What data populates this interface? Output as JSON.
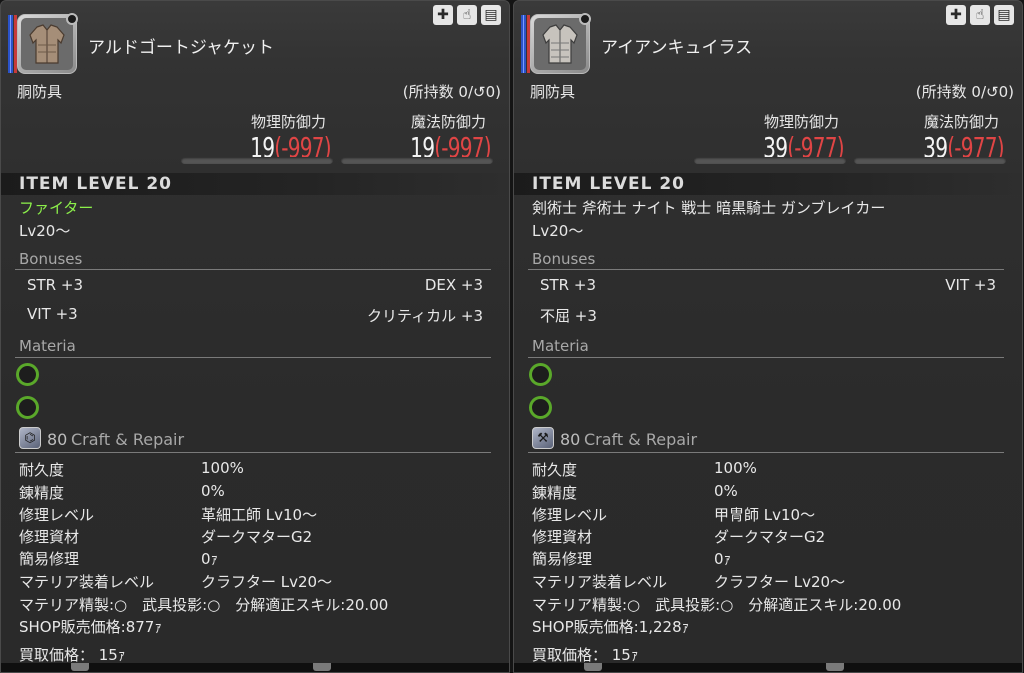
{
  "panels": [
    {
      "item_name": "アルドゴートジャケット",
      "category": "胴防具",
      "owned": "(所持数 0/",
      "owned_suffix": "0)",
      "stats": {
        "phys_label": "物理防御力",
        "phys_base": "19",
        "phys_diff": "(-997)",
        "mag_label": "魔法防御力",
        "mag_base": "19",
        "mag_diff": "(-997)"
      },
      "item_level": "ITEM LEVEL 20",
      "jobs": "ファイター",
      "level_req": "Lv20〜",
      "bonuses_title": "Bonuses",
      "bonuses": [
        "STR +3",
        "DEX +3",
        "VIT +3",
        "クリティカル +3"
      ],
      "materia_title": "Materia",
      "craft_num": "80",
      "craft_title": "Craft & Repair",
      "rows": [
        {
          "label": "耐久度",
          "value": "100%"
        },
        {
          "label": "錬精度",
          "value": "0%"
        },
        {
          "label": "修理レベル",
          "value": "革細工師 Lv10〜"
        },
        {
          "label": "修理資材",
          "value": "ダークマターG2"
        },
        {
          "label": "簡易修理",
          "value": "0ｧ"
        },
        {
          "label": "マテリア装着レベル",
          "value": "クラフター Lv20〜"
        }
      ],
      "misc1": "マテリア精製:○　武具投影:○　分解適正スキル:20.00",
      "shop_price": "SHOP販売価格:877ｧ",
      "buy_price": "買取価格：  15ｧ"
    },
    {
      "item_name": "アイアンキュイラス",
      "category": "胴防具",
      "owned": "(所持数 0/",
      "owned_suffix": "0)",
      "stats": {
        "phys_label": "物理防御力",
        "phys_base": "39",
        "phys_diff": "(-977)",
        "mag_label": "魔法防御力",
        "mag_base": "39",
        "mag_diff": "(-977)"
      },
      "item_level": "ITEM LEVEL 20",
      "jobs": "剣術士 斧術士 ナイト 戦士 暗黒騎士 ガンブレイカー",
      "level_req": "Lv20〜",
      "bonuses_title": "Bonuses",
      "bonuses": [
        "STR +3",
        "VIT +3",
        "不屈 +3"
      ],
      "materia_title": "Materia",
      "craft_num": "80",
      "craft_title": "Craft & Repair",
      "rows": [
        {
          "label": "耐久度",
          "value": "100%"
        },
        {
          "label": "錬精度",
          "value": "0%"
        },
        {
          "label": "修理レベル",
          "value": "甲冑師 Lv10〜"
        },
        {
          "label": "修理資材",
          "value": "ダークマターG2"
        },
        {
          "label": "簡易修理",
          "value": "0ｧ"
        },
        {
          "label": "マテリア装着レベル",
          "value": "クラフター Lv20〜"
        }
      ],
      "misc1": "マテリア精製:○　武具投影:○　分解適正スキル:20.00",
      "shop_price": "SHOP販売価格:1,228ｧ",
      "buy_price": "買取価格：  15ｧ"
    }
  ],
  "colors": {
    "job_green": "#8cf04a",
    "diff_red": "#e04545",
    "materia_ring": "#5aa82a"
  },
  "icons": {
    "top": [
      "plus-cross-icon",
      "hand-icon",
      "dresser-icon"
    ],
    "owned_symbol": "spiral-icon"
  }
}
